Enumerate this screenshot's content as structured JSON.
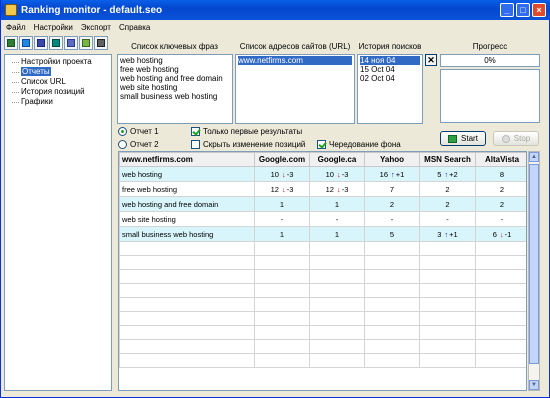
{
  "window": {
    "title": "Ranking monitor - default.seo"
  },
  "menu": [
    "Файл",
    "Настройки",
    "Экспорт",
    "Справка"
  ],
  "toolbar_icons": [
    "new-icon",
    "open-icon",
    "save-icon",
    "run-icon",
    "report-icon",
    "export-icon",
    "print-icon"
  ],
  "tree": {
    "items": [
      "Настройки проекта",
      "Отчеты",
      "Список URL",
      "История позиций",
      "Графики"
    ],
    "selected": 1
  },
  "keywords": {
    "label": "Список ключевых фраз",
    "items": [
      "web hosting",
      "free web hosting",
      "web hosting and free domain",
      "web site hosting",
      "small business web hosting"
    ]
  },
  "urls": {
    "label": "Список адресов сайтов (URL)",
    "items": [
      "www.netfirms.com"
    ]
  },
  "history": {
    "label": "История поисков",
    "items": [
      "14 ноя 04",
      "15 Oct 04",
      "02 Oct 04"
    ]
  },
  "progress": {
    "label": "Прогресс",
    "value_text": "0%",
    "value": 0
  },
  "options": {
    "report1": "Отчет 1",
    "report2": "Отчет 2",
    "first_only": "Только первые результаты",
    "hide_changes": "Скрыть изменение позиций",
    "alternate_bg": "Чередование фона"
  },
  "buttons": {
    "start": "Start",
    "stop": "Stop"
  },
  "colors": {
    "selection": "#316ac5",
    "alt_row": "#d7f5fb",
    "up_arrow": "#1030c0",
    "down_arrow": "#d01010"
  },
  "table": {
    "headers": [
      "www.netfirms.com",
      "Google.com",
      "Google.ca",
      "Yahoo",
      "MSN Search",
      "AltaVista"
    ],
    "rows": [
      [
        {
          "t": "web hosting"
        },
        {
          "t": "10",
          "a": "↓",
          "d": "-3",
          "c": "down"
        },
        {
          "t": "10",
          "a": "↓",
          "d": "-3",
          "c": "down"
        },
        {
          "t": "16",
          "a": "↑",
          "d": "+1",
          "c": "up"
        },
        {
          "t": "5",
          "a": "↑",
          "d": "+2",
          "c": "up"
        },
        {
          "t": "8"
        }
      ],
      [
        {
          "t": "free web hosting"
        },
        {
          "t": "12",
          "a": "↓",
          "d": "-3",
          "c": "down"
        },
        {
          "t": "12",
          "a": "↓",
          "d": "-3",
          "c": "down"
        },
        {
          "t": "7"
        },
        {
          "t": "2"
        },
        {
          "t": "2"
        }
      ],
      [
        {
          "t": "web hosting and free domain"
        },
        {
          "t": "1"
        },
        {
          "t": "1"
        },
        {
          "t": "2"
        },
        {
          "t": "2"
        },
        {
          "t": "2"
        }
      ],
      [
        {
          "t": "web site hosting"
        },
        {
          "t": "-"
        },
        {
          "t": "-"
        },
        {
          "t": "-"
        },
        {
          "t": "-"
        },
        {
          "t": "-"
        }
      ],
      [
        {
          "t": "small business web hosting"
        },
        {
          "t": "1"
        },
        {
          "t": "1"
        },
        {
          "t": "5"
        },
        {
          "t": "3",
          "a": "↑",
          "d": "+1",
          "c": "up"
        },
        {
          "t": "6",
          "a": "↓",
          "d": "-1",
          "c": "down"
        }
      ]
    ]
  }
}
